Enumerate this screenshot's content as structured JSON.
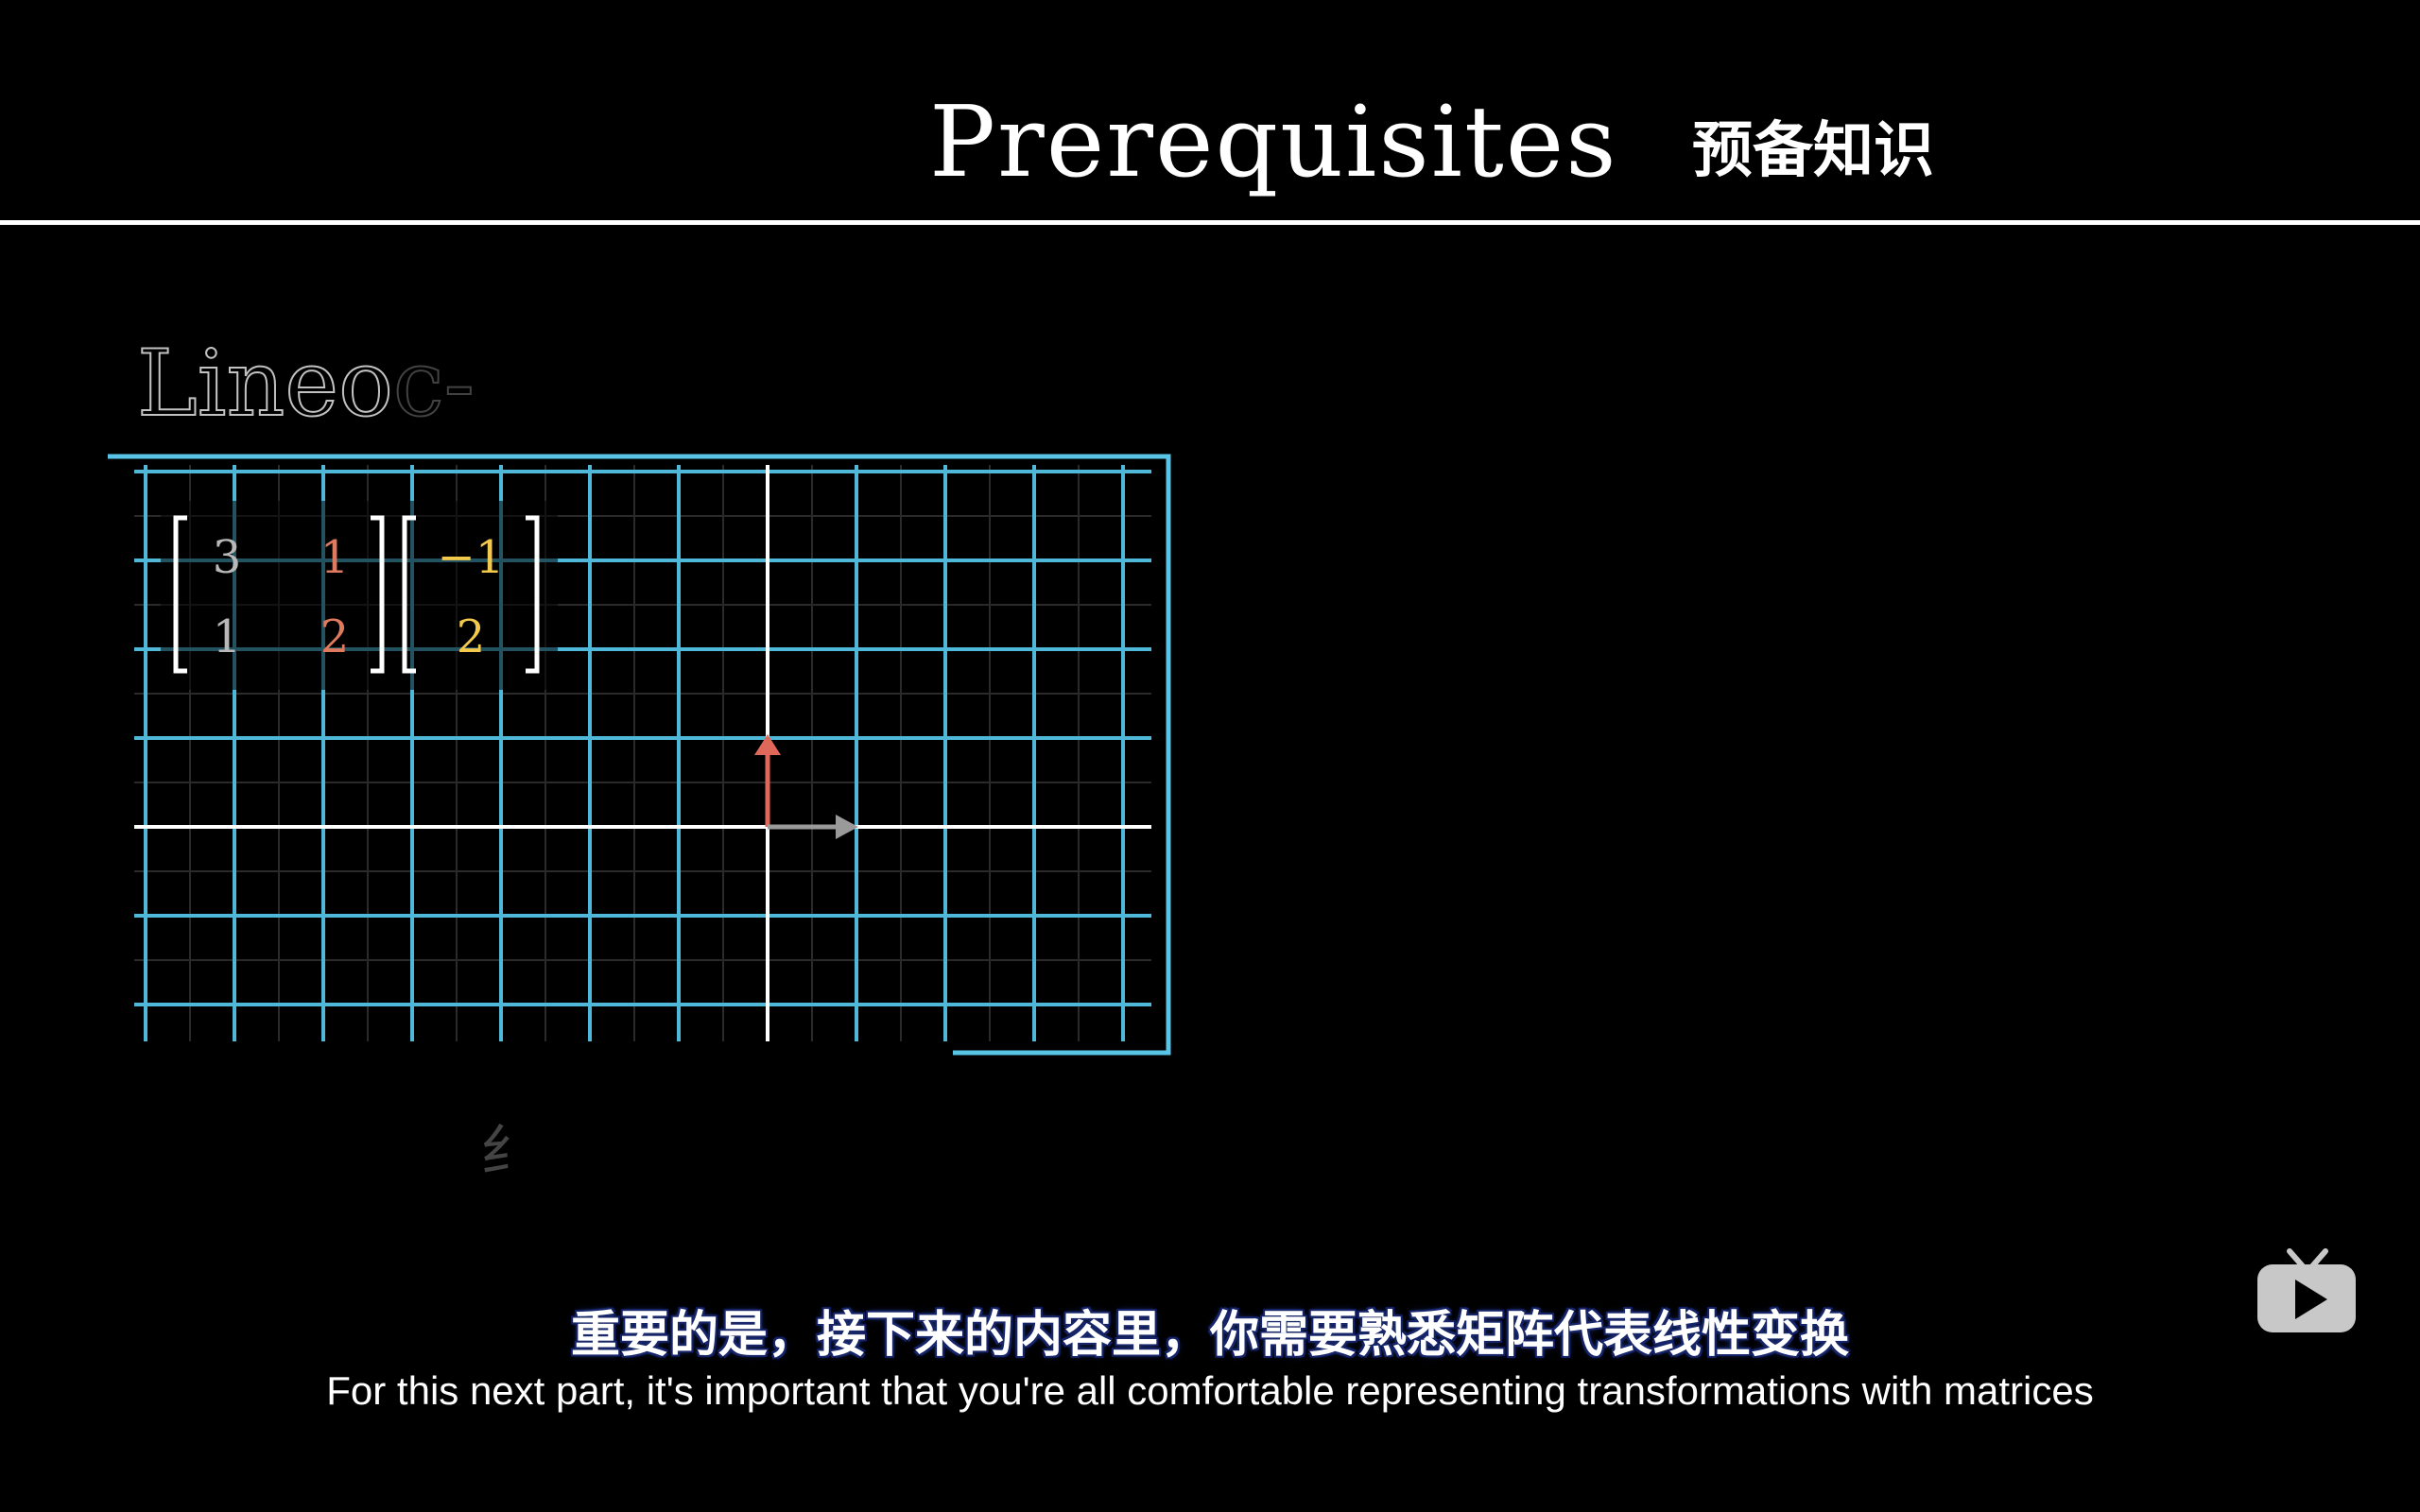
{
  "header": {
    "title": "Prerequisites",
    "title_cn": "预备知识"
  },
  "faded_heading": {
    "visible": "Lineo",
    "tail": "c-"
  },
  "faded_cn_glyph": "纟",
  "matrix": {
    "left": [
      [
        "3",
        "1"
      ],
      [
        "1",
        "2"
      ]
    ],
    "vector": [
      "−1",
      "2"
    ],
    "colors": {
      "col1": "#b8b8b8",
      "col2": "#e07a5f",
      "vector": "#f2c94c"
    }
  },
  "grid": {
    "line_color": "#4fb8d8",
    "frame_color": "#58c4e6",
    "axis_color": "#ffffff"
  },
  "vectors": {
    "j_hat_color": "#e0685a",
    "i_hat_color": "#9a9a9a"
  },
  "subtitles": {
    "cn": "重要的是，接下来的内容里，你需要熟悉矩阵代表线性变换",
    "en": "For this next part, it's important that you're all comfortable representing transformations with matrices"
  },
  "icons": {
    "watermark": "tv-play-icon"
  }
}
